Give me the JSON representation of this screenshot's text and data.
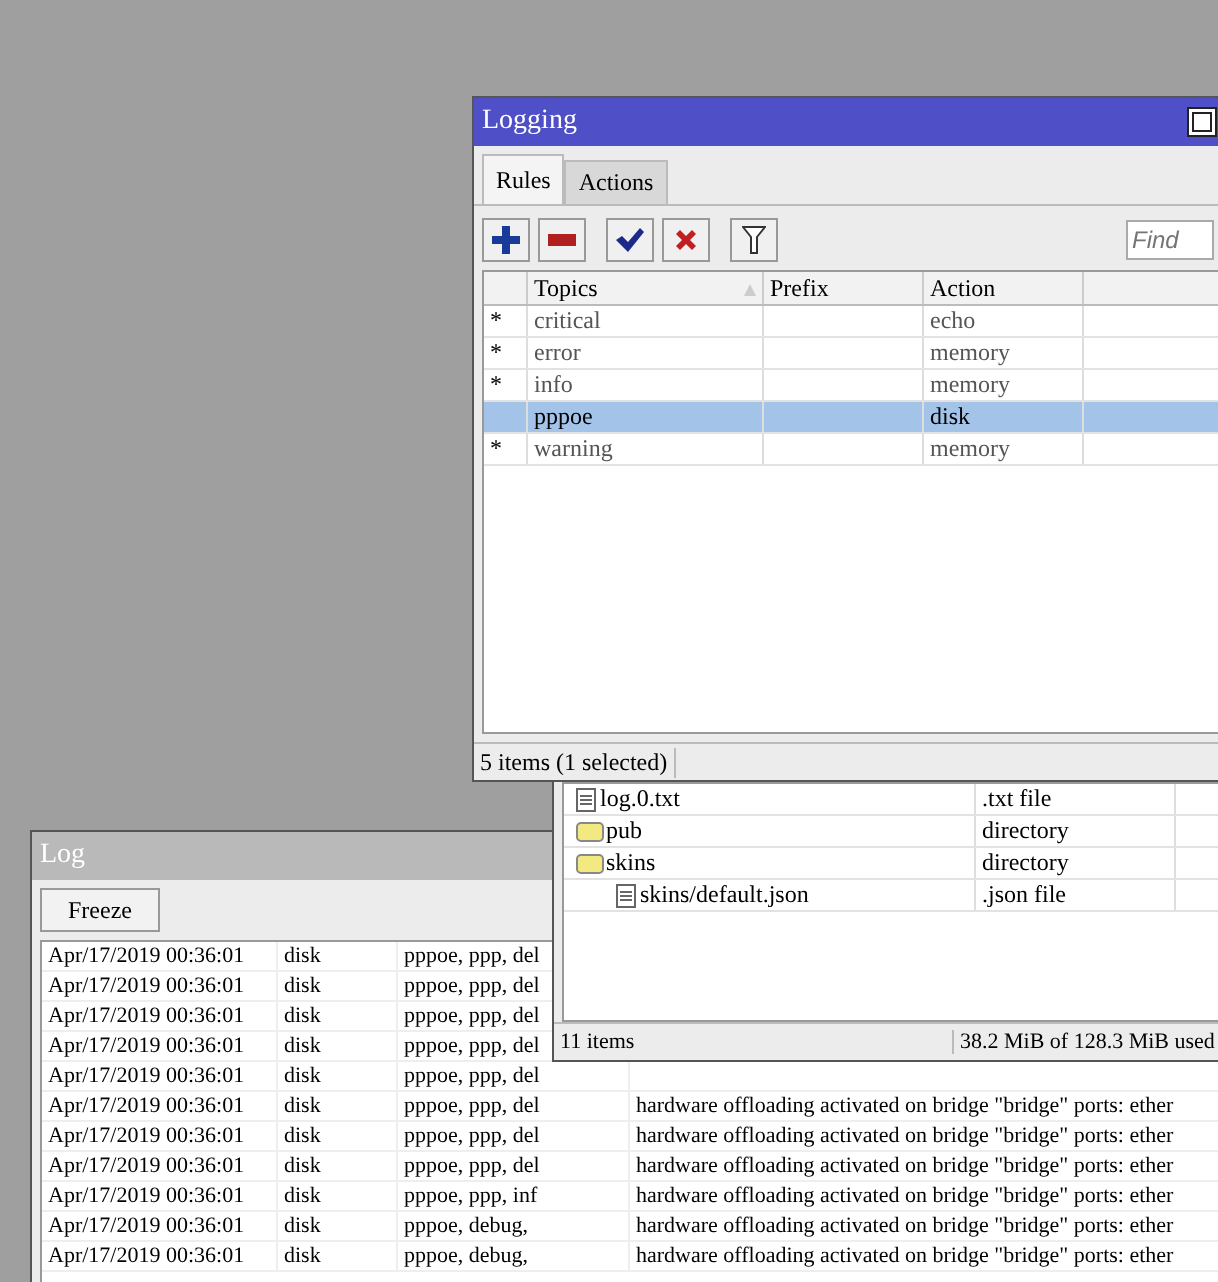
{
  "logging_window": {
    "title": "Logging",
    "active": true,
    "tabs": [
      {
        "label": "Rules",
        "selected": true
      },
      {
        "label": "Actions",
        "selected": false
      }
    ],
    "search": {
      "placeholder": "Find"
    },
    "columns": [
      "Topics",
      "Prefix",
      "Action"
    ],
    "rows": [
      {
        "flag": "*",
        "topics": "critical",
        "prefix": "",
        "action": "echo",
        "selected": false
      },
      {
        "flag": "*",
        "topics": "error",
        "prefix": "",
        "action": "memory",
        "selected": false
      },
      {
        "flag": "*",
        "topics": "info",
        "prefix": "",
        "action": "memory",
        "selected": false
      },
      {
        "flag": "",
        "topics": "pppoe",
        "prefix": "",
        "action": "disk",
        "selected": true
      },
      {
        "flag": "*",
        "topics": "warning",
        "prefix": "",
        "action": "memory",
        "selected": false
      }
    ],
    "status": "5 items (1 selected)"
  },
  "files_window": {
    "rows": [
      {
        "kind": "file",
        "name": "log.0.txt",
        "type": ".txt file",
        "children": []
      },
      {
        "kind": "folder",
        "name": "pub",
        "type": "directory",
        "children": []
      },
      {
        "kind": "folder",
        "name": "skins",
        "type": "directory",
        "children": [
          {
            "kind": "file",
            "name": "skins/default.json",
            "type": ".json file"
          }
        ]
      }
    ],
    "status": [
      "11 items",
      "38.2 MiB of 128.3 MiB used"
    ]
  },
  "log_window": {
    "title": "Log",
    "active": false,
    "freeze_button": "Freeze",
    "rows": [
      {
        "time": "Apr/17/2019 00:36:01",
        "buffer": "disk",
        "topics": "pppoe, ppp, del",
        "message": ""
      },
      {
        "time": "Apr/17/2019 00:36:01",
        "buffer": "disk",
        "topics": "pppoe, ppp, del",
        "message": ""
      },
      {
        "time": "Apr/17/2019 00:36:01",
        "buffer": "disk",
        "topics": "pppoe, ppp, del",
        "message": ""
      },
      {
        "time": "Apr/17/2019 00:36:01",
        "buffer": "disk",
        "topics": "pppoe, ppp, del",
        "message": ""
      },
      {
        "time": "Apr/17/2019 00:36:01",
        "buffer": "disk",
        "topics": "pppoe, ppp, del",
        "message": ""
      },
      {
        "time": "Apr/17/2019 00:36:01",
        "buffer": "disk",
        "topics": "pppoe, ppp, del",
        "message": "hardware offloading activated on bridge \"bridge\" ports: ether"
      },
      {
        "time": "Apr/17/2019 00:36:01",
        "buffer": "disk",
        "topics": "pppoe, ppp, del",
        "message": "hardware offloading activated on bridge \"bridge\" ports: ether"
      },
      {
        "time": "Apr/17/2019 00:36:01",
        "buffer": "disk",
        "topics": "pppoe, ppp, del",
        "message": "hardware offloading activated on bridge \"bridge\" ports: ether"
      },
      {
        "time": "Apr/17/2019 00:36:01",
        "buffer": "disk",
        "topics": "pppoe, ppp, inf",
        "message": "hardware offloading activated on bridge \"bridge\" ports: ether"
      },
      {
        "time": "Apr/17/2019 00:36:01",
        "buffer": "disk",
        "topics": "pppoe, debug,",
        "message": "hardware offloading activated on bridge \"bridge\" ports: ether"
      },
      {
        "time": "Apr/17/2019 00:36:01",
        "buffer": "disk",
        "topics": "pppoe, debug,",
        "message": "hardware offloading activated on bridge \"bridge\" ports: ether"
      }
    ]
  }
}
